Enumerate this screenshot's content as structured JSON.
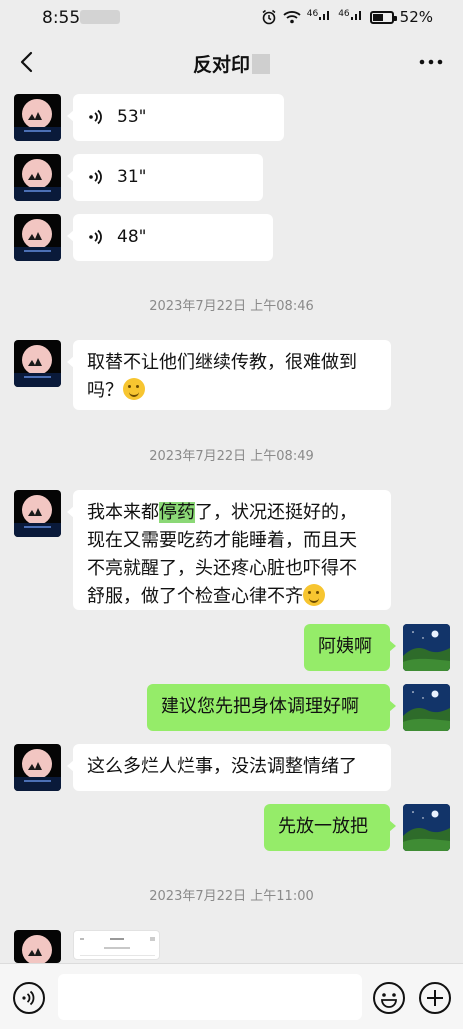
{
  "status_bar": {
    "time": "8:55",
    "battery": "52%",
    "signal_label_1": "46",
    "signal_label_2": "46"
  },
  "header": {
    "title": "反对印"
  },
  "messages": [
    {
      "type": "voice",
      "side": "left",
      "duration": "53\""
    },
    {
      "type": "voice",
      "side": "left",
      "duration": "31\""
    },
    {
      "type": "voice",
      "side": "left",
      "duration": "48\""
    },
    {
      "type": "time",
      "text": "2023年7月22日 上午08:46"
    },
    {
      "type": "text",
      "side": "left",
      "line1": "取替不让他们继续传教，很难做到",
      "line2": "吗？"
    },
    {
      "type": "time",
      "text": "2023年7月22日 上午08:49"
    },
    {
      "type": "text",
      "side": "left",
      "pre": "我本来都",
      "highlight": "停药",
      "post": "了，状况还挺好的，",
      "line2": "现在又需要吃药才能睡着，而且天",
      "line3": "不亮就醒了，头还疼心脏也吓得不",
      "line4": "舒服，做了个检查心律不齐"
    },
    {
      "type": "text",
      "side": "right",
      "text": "阿姨啊"
    },
    {
      "type": "text",
      "side": "right",
      "text": "建议您先把身体调理好啊"
    },
    {
      "type": "text",
      "side": "left",
      "text": "这么多烂人烂事，没法调整情绪了"
    },
    {
      "type": "text",
      "side": "right",
      "text": "先放一放把"
    },
    {
      "type": "time",
      "text": "2023年7月22日 上午11:00"
    },
    {
      "type": "image",
      "side": "left"
    }
  ],
  "icons": {
    "back": "chevron-left-icon",
    "more": "more-dots-icon",
    "voice": "voice-wave-icon",
    "voice_input": "voice-input-icon",
    "emoji": "emoji-icon",
    "add": "add-icon"
  },
  "colors": {
    "background": "#ededed",
    "self_bubble": "#95ec69",
    "other_bubble": "#ffffff",
    "highlight": "#8bd876"
  }
}
